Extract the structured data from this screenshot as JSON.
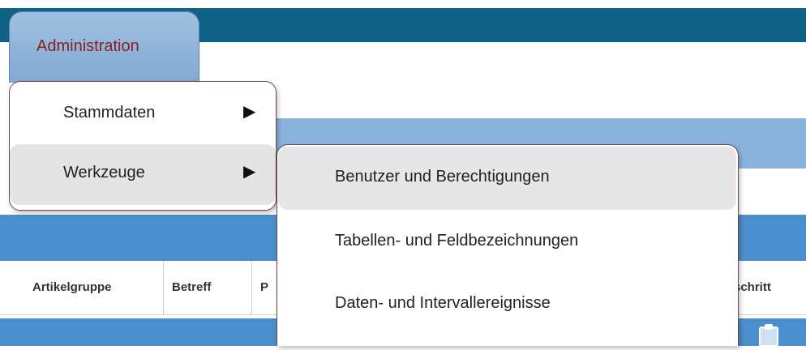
{
  "nav": {
    "admin_tab": "Administration"
  },
  "menu": {
    "items": [
      {
        "label": "Stammdaten",
        "arrow": "▶"
      },
      {
        "label": "Werkzeuge",
        "arrow": "▶"
      }
    ]
  },
  "submenu": {
    "items": [
      {
        "label": "Benutzer und Berechtigungen"
      },
      {
        "label": "Tabellen- und Feldbezeichnungen"
      },
      {
        "label": "Daten- und Intervallereignisse"
      }
    ]
  },
  "table": {
    "headers": [
      "Artikelgruppe",
      "Betreff",
      "P",
      "tschritt"
    ]
  },
  "colors": {
    "topbar": "#0f6186",
    "tab": "#8fb4db",
    "band_blue": "#4a8ecd",
    "admin_text": "#8a1f1f"
  },
  "icons": {
    "clipboard": "clipboard-icon",
    "arrow": "triangle-right-icon"
  }
}
